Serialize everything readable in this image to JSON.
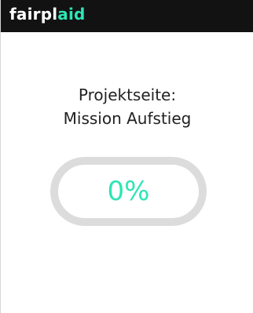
{
  "header": {
    "logo_part1": "fairpl",
    "logo_part2": "aid",
    "bg_color": "#121212",
    "accent_color": "#2ee5b5"
  },
  "main": {
    "title_line1": "Projektseite:",
    "title_line2": "Mission Aufstieg",
    "progress": {
      "label": "0%",
      "fraction": 0.0
    }
  }
}
